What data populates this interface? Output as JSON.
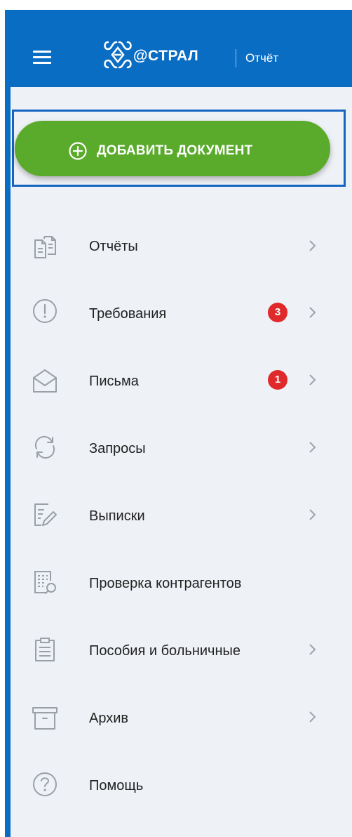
{
  "header": {
    "brand": "@СТРАЛ",
    "product": "Отчёт"
  },
  "add_button": {
    "label": "ДОБАВИТЬ ДОКУМЕНТ"
  },
  "menu": {
    "items": [
      {
        "label": "Отчёты",
        "icon": "documents-icon",
        "has_chevron": true
      },
      {
        "label": "Требования",
        "icon": "exclamation-circle-icon",
        "badge": "3",
        "has_chevron": true
      },
      {
        "label": "Письма",
        "icon": "envelope-icon",
        "badge": "1",
        "has_chevron": true
      },
      {
        "label": "Запросы",
        "icon": "refresh-icon",
        "has_chevron": true
      },
      {
        "label": "Выписки",
        "icon": "document-edit-icon",
        "has_chevron": true
      },
      {
        "label": "Проверка контрагентов",
        "icon": "document-search-icon",
        "has_chevron": false
      },
      {
        "label": "Пособия и больничные",
        "icon": "clipboard-icon",
        "has_chevron": true
      },
      {
        "label": "Архив",
        "icon": "archive-box-icon",
        "has_chevron": true
      },
      {
        "label": "Помощь",
        "icon": "question-circle-icon",
        "has_chevron": false
      }
    ]
  },
  "colors": {
    "header_bg": "#0a6dc4",
    "sidebar_bg": "#eef1f6",
    "add_button_bg": "#5aab2c",
    "badge_bg": "#e0292b",
    "icon_gray": "#9aa0a6"
  }
}
